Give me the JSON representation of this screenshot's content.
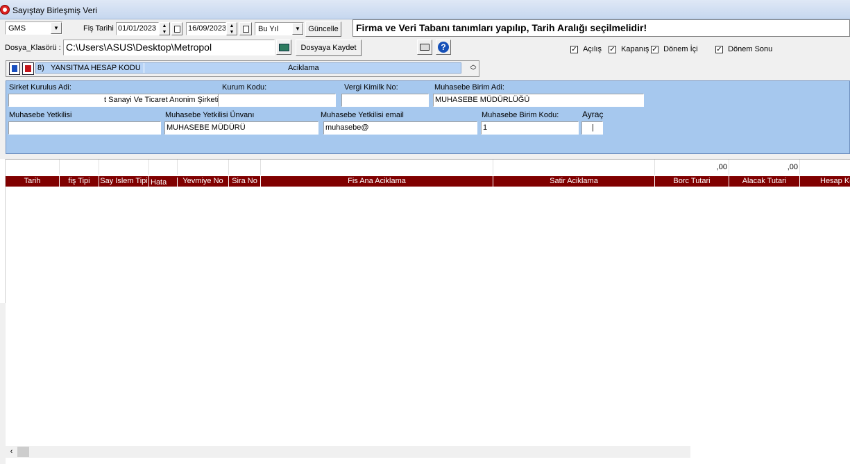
{
  "window": {
    "title": "Sayıştay Birleşmiş Veri"
  },
  "toolbar": {
    "company_select": "GMS",
    "fis_tarihi_label": "Fiş Tarihi :",
    "start_date": "01/01/2023",
    "end_date": "16/09/2023",
    "period_select": "Bu Yıl",
    "update_button": "Güncelle",
    "status_message": "Firma ve Veri Tabanı tanımları yapılıp, Tarih Aralığı seçilmelidir!"
  },
  "file": {
    "label": "Dosya_Klasörü :",
    "path": "C:\\Users\\ASUS\\Desktop\\Metropol",
    "save_button": "Dosyaya Kaydet"
  },
  "options": {
    "acilis": {
      "label": "Açılış",
      "checked": true
    },
    "kapanis": {
      "label": "Kapanış",
      "checked": true
    },
    "donem_ici": {
      "label": "Dönem İçi",
      "checked": true
    },
    "donem_sonu": {
      "label": "Dönem Sonu",
      "checked": true
    },
    "check_glyph": "✓"
  },
  "account_bar": {
    "code": "8)",
    "code_label": "YANSITMA HESAP KODU",
    "description_label": "Aciklama"
  },
  "company_info": {
    "sirket_label": "Sirket Kurulus Adi:",
    "sirket_value": "t Sanayi Ve Ticaret Anonim Şirketi",
    "kurum_label": "Kurum Kodu:",
    "kurum_value": "",
    "vergi_label": "Vergi Kimilk No:",
    "vergi_value": "",
    "birim_adi_label": "Muhasebe Birim Adi:",
    "birim_adi_value": "MUHASEBE MÜDÜRLÜĞÜ",
    "yetkili_label": "Muhasebe Yetkilisi",
    "yetkili_value": "",
    "unvan_label": "Muhasebe Yetkilisi Ünvanı",
    "unvan_value": "MUHASEBE MÜDÜRÜ",
    "email_label": "Muhasebe Yetkilisi email",
    "email_value": "muhasebe@",
    "birim_kodu_label": "Muhasebe Birim Kodu:",
    "birim_kodu_value": "1",
    "ayrac_label": "Ayraç",
    "ayrac_value": "|"
  },
  "grid": {
    "totals": {
      "borc": ",00",
      "alacak": ",00"
    },
    "columns": [
      "Tarih",
      "fiş Tipi",
      "Say Islem Tipi",
      "Hata",
      "Yevmiye No",
      "Sira No",
      "Fis Ana Aciklama",
      "Satir Aciklama",
      "Borc Tutari",
      "Alacak Tutari",
      "Hesap Kodu"
    ],
    "rows": []
  },
  "colors": {
    "header_bg": "#800000",
    "info_panel_bg": "#a6c8ee",
    "account_bar_bg": "#b7d3f5"
  }
}
